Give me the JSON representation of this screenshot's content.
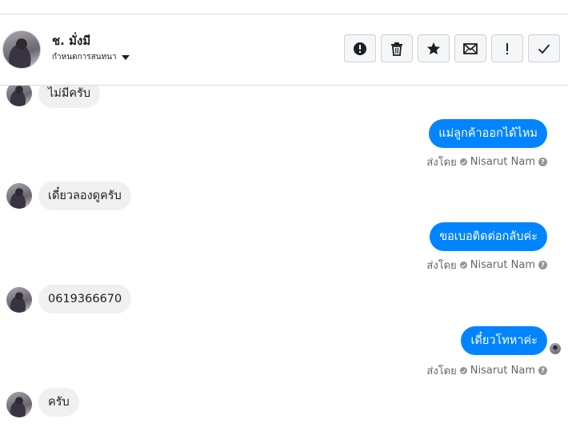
{
  "header": {
    "contact_name": "ช. มั่งมี",
    "assign_label": "กำหนดการสนทนา",
    "actions": [
      {
        "name": "mark-spam-button",
        "icon": "alert-circle-icon"
      },
      {
        "name": "delete-button",
        "icon": "trash-icon"
      },
      {
        "name": "star-button",
        "icon": "star-icon"
      },
      {
        "name": "mark-unread-button",
        "icon": "envelope-icon"
      },
      {
        "name": "follow-up-button",
        "icon": "exclamation-icon"
      },
      {
        "name": "mark-done-button",
        "icon": "checkmark-icon"
      }
    ]
  },
  "messages": [
    {
      "direction": "in",
      "text": "ไม่มีครับ"
    },
    {
      "direction": "out",
      "text": "แม่ลูกค้าออกได้ไหม",
      "sent_by_prefix": "ส่งโดย",
      "sender": "Nisarut Nam"
    },
    {
      "direction": "in",
      "text": "เดี๋ยวลองดูครับ"
    },
    {
      "direction": "out",
      "text": "ขอเบอติดต่อกลับค่ะ",
      "sent_by_prefix": "ส่งโดย",
      "sender": "Nisarut Nam"
    },
    {
      "direction": "in",
      "text": "0619366670"
    },
    {
      "direction": "out",
      "text": "เดี๋ยวโทหาค่ะ",
      "sent_by_prefix": "ส่งโดย",
      "sender": "Nisarut Nam"
    },
    {
      "direction": "in",
      "text": "ครับ"
    }
  ],
  "colors": {
    "outgoing_bubble": "#0084ff",
    "incoming_bubble": "#f1f0f0",
    "meta_text": "#606770"
  }
}
